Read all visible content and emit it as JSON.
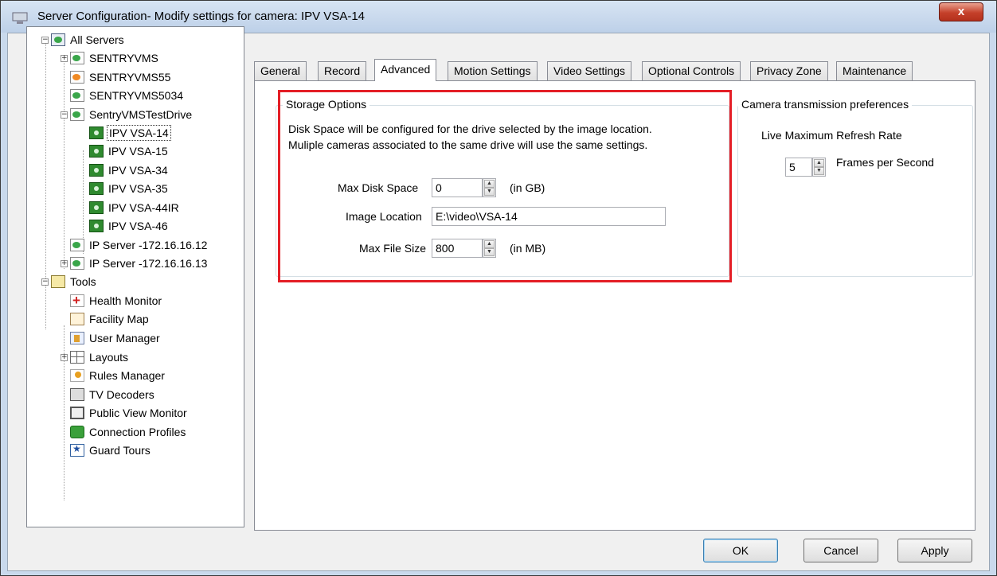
{
  "window": {
    "title": "Server Configuration- Modify settings for camera: IPV VSA-14",
    "close_label": "x"
  },
  "tree": {
    "root": "All Servers",
    "servers": [
      {
        "label": "SENTRYVMS",
        "icon": "server-icon"
      },
      {
        "label": "SENTRYVMS55",
        "icon": "server-icon"
      },
      {
        "label": "SENTRYVMS5034",
        "icon": "server-icon"
      },
      {
        "label": "SentryVMSTestDrive",
        "icon": "server-icon"
      }
    ],
    "cameras": [
      "IPV VSA-14",
      "IPV VSA-15",
      "IPV VSA-34",
      "IPV VSA-35",
      "IPV VSA-44IR",
      "IPV VSA-46"
    ],
    "ip_servers": [
      "IP Server -172.16.16.12",
      "IP Server -172.16.16.13"
    ],
    "tools_label": "Tools",
    "tools": [
      "Health Monitor",
      "Facility Map",
      "User Manager",
      "Layouts",
      "Rules Manager",
      "TV Decoders",
      "Public View Monitor",
      "Connection Profiles",
      "Guard Tours"
    ]
  },
  "tabs": [
    "General",
    "Record",
    "Advanced",
    "Motion Settings",
    "Video Settings",
    "Optional Controls",
    "Privacy Zone",
    "Maintenance"
  ],
  "active_tab": "Advanced",
  "storage": {
    "title": "Storage Options",
    "desc_line1": "Disk Space will be configured for the drive selected by the image location.",
    "desc_line2": "Muliple cameras associated to the same drive will use the same settings.",
    "max_disk_label": "Max Disk Space",
    "max_disk_value": "0",
    "max_disk_unit": "(in GB)",
    "image_location_label": "Image Location",
    "image_location_value": "E:\\video\\VSA-14",
    "max_file_label": "Max File Size",
    "max_file_value": "800",
    "max_file_unit": "(in MB)"
  },
  "transmission": {
    "title": "Camera transmission preferences",
    "refresh_label": "Live Maximum Refresh Rate",
    "fps_value": "5",
    "fps_unit": "Frames per Second"
  },
  "buttons": {
    "ok": "OK",
    "cancel": "Cancel",
    "apply": "Apply"
  },
  "colors": {
    "highlight": "#e41e26",
    "close_button": "#c5402a"
  }
}
